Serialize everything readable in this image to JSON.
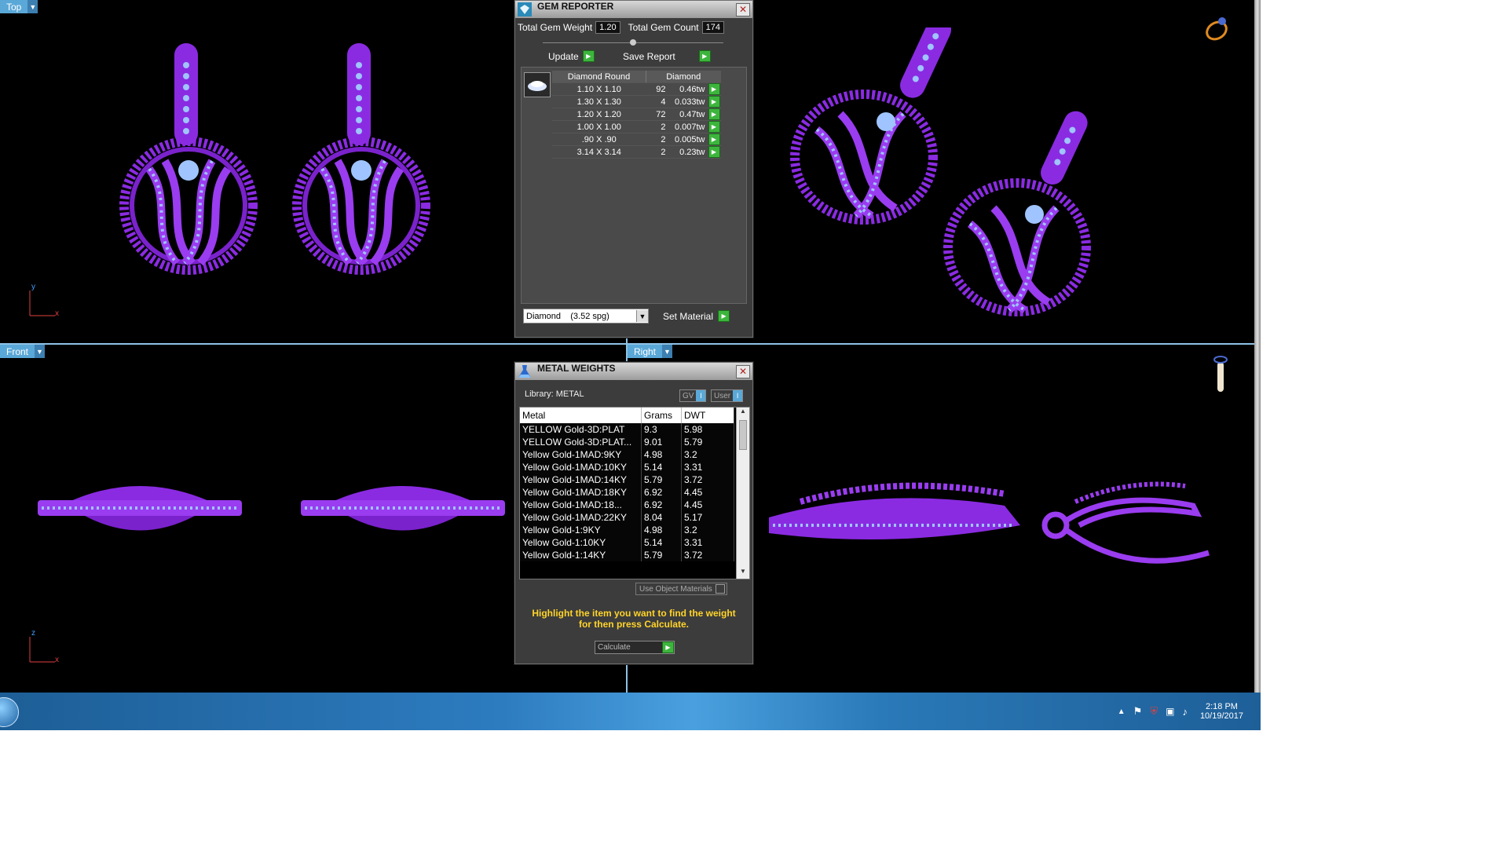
{
  "viewports": {
    "top": {
      "label": "Top"
    },
    "front": {
      "label": "Front"
    },
    "right": {
      "label": "Right"
    },
    "axes": {
      "top_y": "y",
      "top_x": "x",
      "front_z": "z",
      "front_x": "x"
    }
  },
  "gem_reporter": {
    "title": "GEM REPORTER",
    "total_weight_label": "Total Gem Weight",
    "total_weight_value": "1.20",
    "total_count_label": "Total Gem Count",
    "total_count_value": "174",
    "update_label": "Update",
    "save_report_label": "Save Report",
    "col_shape": "Diamond Round",
    "col_material": "Diamond",
    "rows": [
      {
        "size": "1.10 X 1.10",
        "count": "92",
        "weight": "0.46tw"
      },
      {
        "size": "1.30 X 1.30",
        "count": "4",
        "weight": "0.033tw"
      },
      {
        "size": "1.20 X 1.20",
        "count": "72",
        "weight": "0.47tw"
      },
      {
        "size": "1.00 X 1.00",
        "count": "2",
        "weight": "0.007tw"
      },
      {
        "size": ".90 X .90",
        "count": "2",
        "weight": "0.005tw"
      },
      {
        "size": "3.14 X 3.14",
        "count": "2",
        "weight": "0.23tw"
      }
    ],
    "material_select": "Diamond    (3.52 spg)",
    "set_material_label": "Set Material"
  },
  "metal_weights": {
    "title": "METAL WEIGHTS",
    "library_label": "Library: METAL",
    "gv_label": "GV",
    "user_label": "User",
    "col_metal": "Metal",
    "col_grams": "Grams",
    "col_dwt": "DWT",
    "rows": [
      {
        "metal": "YELLOW Gold-3D:PLAT",
        "grams": "9.3",
        "dwt": "5.98"
      },
      {
        "metal": "YELLOW Gold-3D:PLAT...",
        "grams": "9.01",
        "dwt": "5.79"
      },
      {
        "metal": "Yellow Gold-1MAD:9KY",
        "grams": "4.98",
        "dwt": "3.2"
      },
      {
        "metal": "Yellow Gold-1MAD:10KY",
        "grams": "5.14",
        "dwt": "3.31"
      },
      {
        "metal": "Yellow Gold-1MAD:14KY",
        "grams": "5.79",
        "dwt": "3.72"
      },
      {
        "metal": "Yellow Gold-1MAD:18KY",
        "grams": "6.92",
        "dwt": "4.45"
      },
      {
        "metal": "Yellow Gold-1MAD:18...",
        "grams": "6.92",
        "dwt": "4.45"
      },
      {
        "metal": "Yellow Gold-1MAD:22KY",
        "grams": "8.04",
        "dwt": "5.17"
      },
      {
        "metal": "Yellow Gold-1:9KY",
        "grams": "4.98",
        "dwt": "3.2"
      },
      {
        "metal": "Yellow Gold-1:10KY",
        "grams": "5.14",
        "dwt": "3.31"
      },
      {
        "metal": "Yellow Gold-1:14KY",
        "grams": "5.79",
        "dwt": "3.72"
      }
    ],
    "use_object_materials": "Use Object Materials",
    "hint": "Highlight the item you want to find the weight for then press Calculate.",
    "calculate_label": "Calculate"
  },
  "taskbar": {
    "time": "2:18 PM",
    "date": "10/19/2017"
  },
  "colors": {
    "metal": "#8a2be2",
    "gem": "#8fb8ff",
    "accent": "#5aa8d8",
    "hint": "#ffd42a"
  }
}
